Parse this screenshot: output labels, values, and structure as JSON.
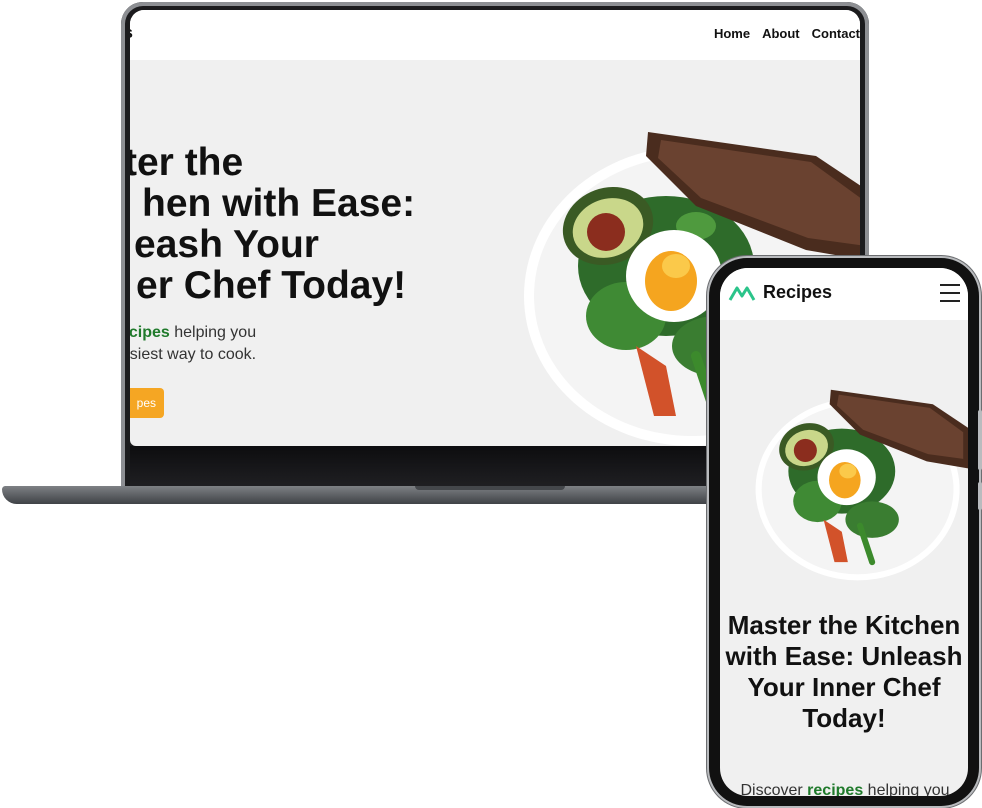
{
  "laptop": {
    "brand_fragment": "es",
    "nav": [
      "Home",
      "About",
      "Contact"
    ],
    "headline_lines": [
      "ter the",
      "hen with Ease:",
      "eash Your",
      "er Chef Today!"
    ],
    "sub_highlight": "ecipes",
    "sub_rest": " helping you",
    "sub_line2": " easiest way to cook.",
    "cta_fragment": "pes"
  },
  "phone": {
    "brand": "Recipes",
    "headline": "Master the Kitchen with Ease: Unleash Your Inner Chef Today!",
    "sub_prefix": "Discover ",
    "sub_highlight": "recipes",
    "sub_suffix": " helping you"
  },
  "colors": {
    "accent_green": "#1f7a2b",
    "logo_green": "#2bc48a",
    "cta_orange": "#f5a623",
    "background": "#f0f0f0"
  },
  "icons": {
    "menu": "hamburger-icon",
    "logo": "recipes-logo-icon"
  }
}
